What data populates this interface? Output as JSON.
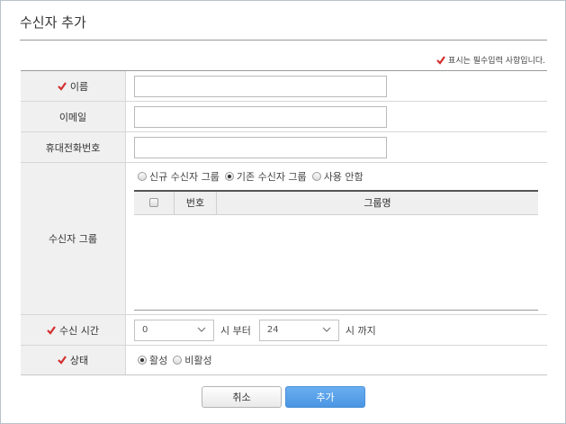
{
  "dialog": {
    "title": "수신자 추가",
    "required_note": "표시는 필수입력 사항입니다."
  },
  "colors": {
    "required_check": "#d32f2f",
    "primary_button": "#4a95e3"
  },
  "form": {
    "name_label": "이름",
    "name_value": "",
    "email_label": "이메일",
    "email_value": "",
    "phone_label": "휴대전화번호",
    "phone_value": "",
    "group_label": "수신자 그룹",
    "group_options": {
      "new": "신규 수신자 그룹",
      "existing": "기존 수신자 그룹",
      "none": "사용 안함"
    },
    "group_selected": "existing",
    "group_table": {
      "col_no": "번호",
      "col_name": "그룹명"
    },
    "time_label": "수신 시간",
    "time_from": "0",
    "time_from_suffix": "시 부터",
    "time_to": "24",
    "time_to_suffix": "시 까지",
    "status_label": "상태",
    "status_options": {
      "active": "활성",
      "inactive": "비활성"
    },
    "status_selected": "active"
  },
  "buttons": {
    "cancel": "취소",
    "add": "추가"
  }
}
